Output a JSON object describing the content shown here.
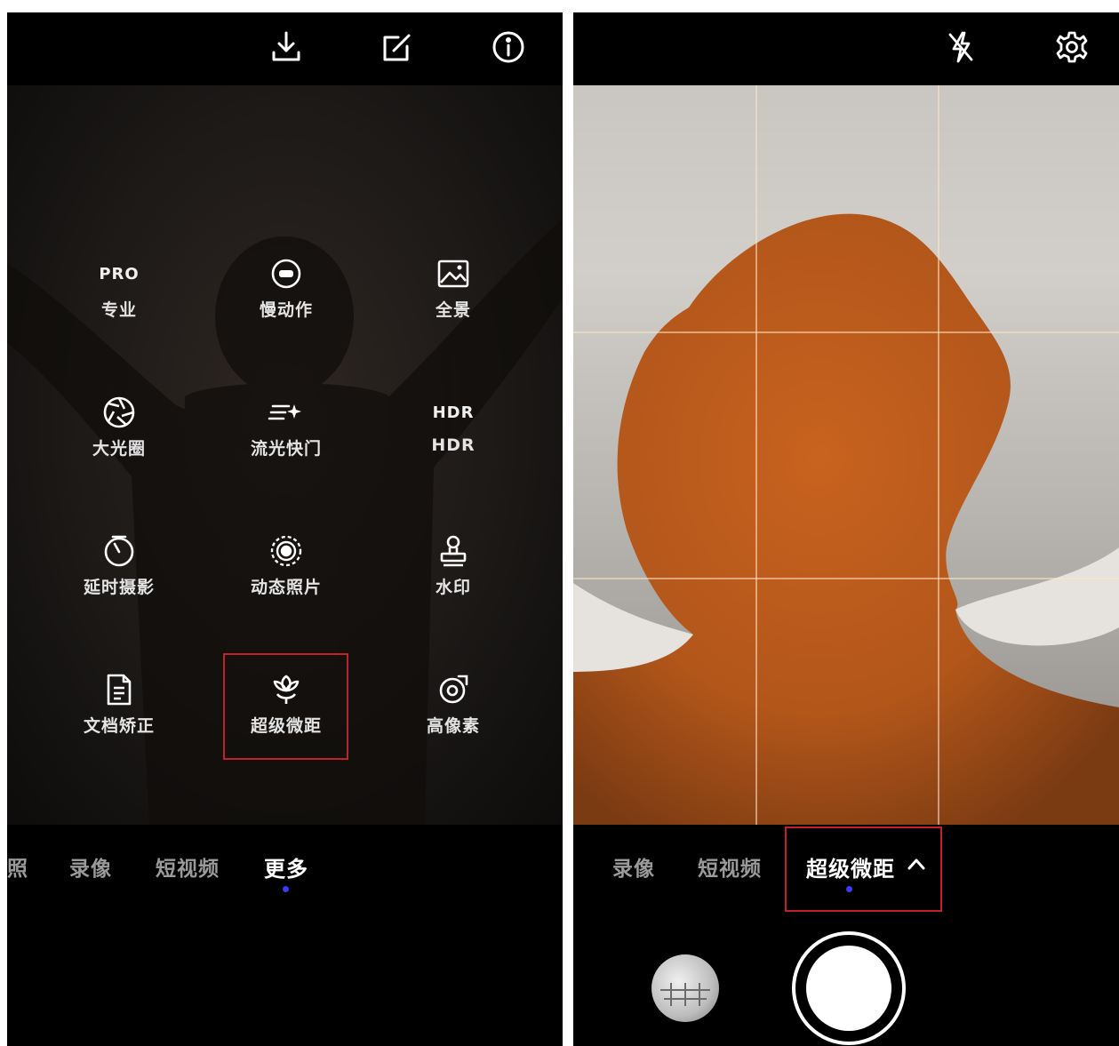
{
  "left": {
    "top_icons": [
      "download-icon",
      "edit-icon",
      "info-icon"
    ],
    "modes": [
      {
        "glyph": "PRO",
        "label": "专业",
        "icon": "pro-text"
      },
      {
        "glyph": "",
        "label": "慢动作",
        "icon": "slow-motion-icon"
      },
      {
        "glyph": "",
        "label": "全景",
        "icon": "panorama-icon"
      },
      {
        "glyph": "",
        "label": "大光圈",
        "icon": "aperture-icon"
      },
      {
        "glyph": "",
        "label": "流光快门",
        "icon": "light-painting-icon"
      },
      {
        "glyph": "HDR",
        "label": "HDR",
        "icon": "hdr-text"
      },
      {
        "glyph": "",
        "label": "延时摄影",
        "icon": "timelapse-icon"
      },
      {
        "glyph": "",
        "label": "动态照片",
        "icon": "moving-picture-icon"
      },
      {
        "glyph": "",
        "label": "水印",
        "icon": "watermark-icon"
      },
      {
        "glyph": "",
        "label": "文档矫正",
        "icon": "document-icon"
      },
      {
        "glyph": "",
        "label": "超级微距",
        "icon": "macro-flower-icon"
      },
      {
        "glyph": "",
        "label": "高像素",
        "icon": "high-res-icon"
      }
    ],
    "tabs": [
      "照",
      "录像",
      "短视频",
      "更多"
    ],
    "active_tab": "更多"
  },
  "right": {
    "top_icons": [
      "flash-off-icon",
      "settings-icon"
    ],
    "tabs": [
      "录像",
      "短视频",
      "超级微距"
    ],
    "active_tab": "超级微距",
    "expand_icon": "chevron-up-icon"
  },
  "colors": {
    "highlight": "#c2202c",
    "indicator": "#3b3bf5",
    "subject": "#b85a1c"
  }
}
